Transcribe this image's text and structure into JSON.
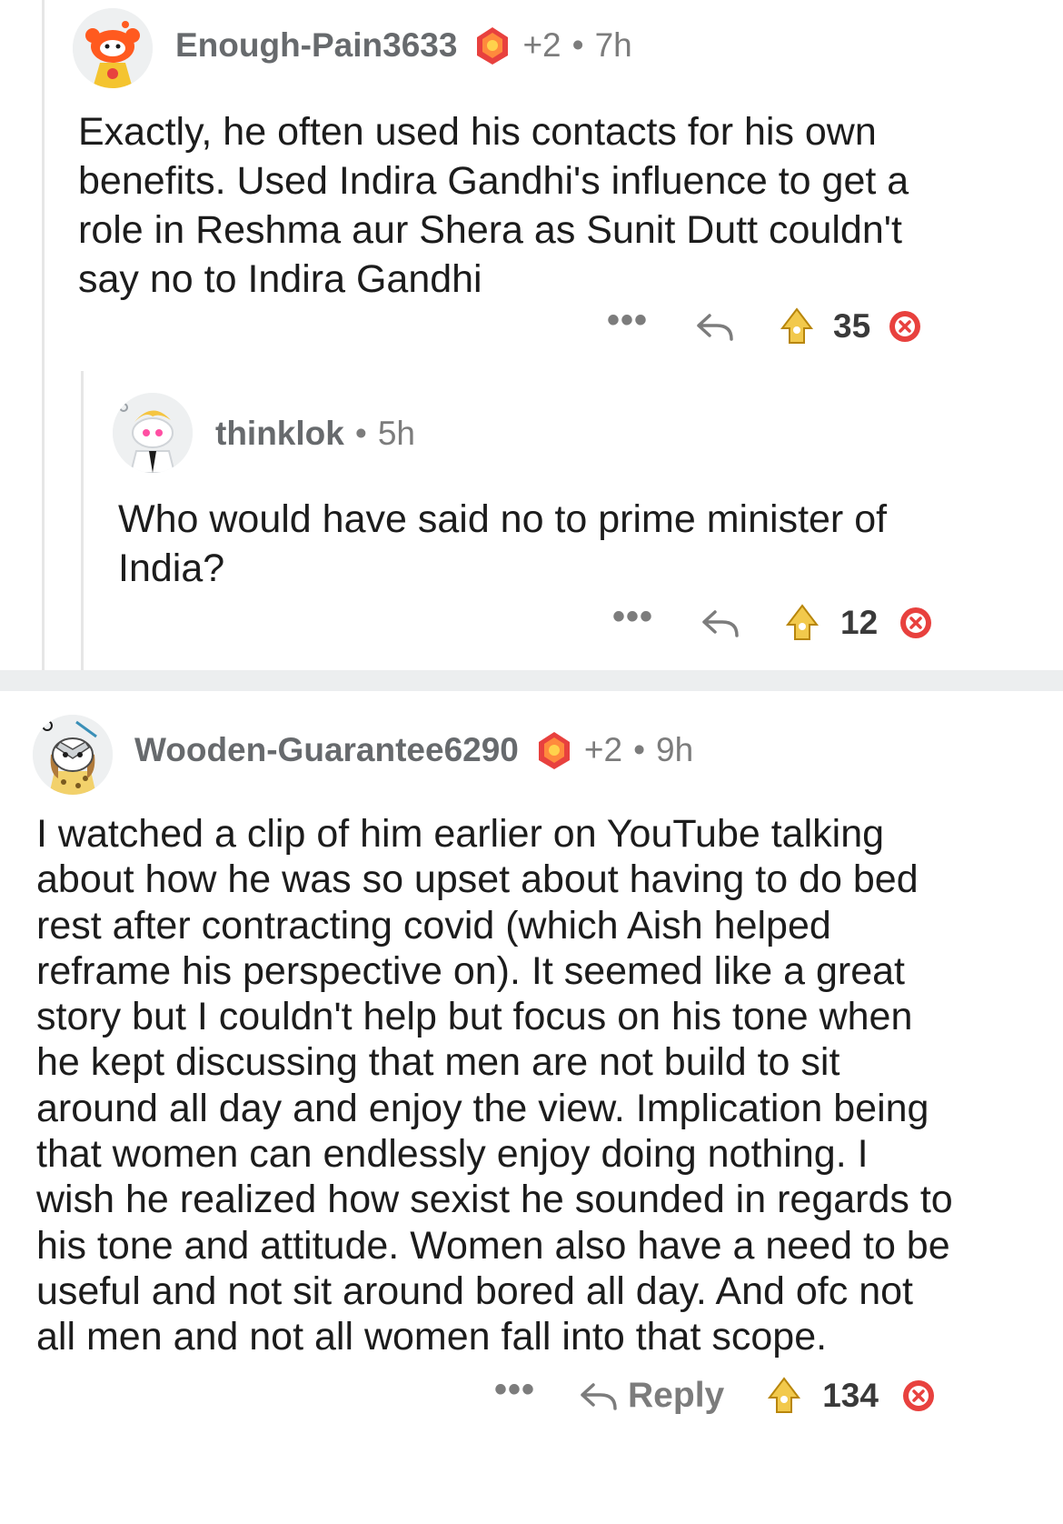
{
  "comments": [
    {
      "username": "Enough-Pain3633",
      "award_count": "+2",
      "separator": "•",
      "time": "7h",
      "body": "Exactly, he often used his contacts for his own\nbenefits. Used Indira Gandhi's influence to get a\nrole in Reshma aur Shera as Sunit Dutt couldn't\nsay no to Indira Gandhi",
      "more": "•••",
      "score": "35"
    },
    {
      "username": "thinklok",
      "separator": "•",
      "time": "5h",
      "body": "Who would have said no to prime minister of\nIndia?",
      "more": "•••",
      "score": "12"
    },
    {
      "username": "Wooden-Guarantee6290",
      "award_count": "+2",
      "separator": "•",
      "time": "9h",
      "body": "I watched a clip of him earlier on YouTube talking\nabout how he was so upset about having to do bed\nrest after contracting covid (which Aish helped\nreframe his perspective on). It seemed like a great\nstory but I couldn't help but focus on his tone when\nhe kept discussing that men are not build to sit\naround all day and enjoy the view. Implication being\nthat women can endlessly enjoy doing nothing. I\nwish he realized how sexist he sounded in regards to\nhis tone and attitude. Women also have a need to be\nuseful and not sit around bored all day. And ofc not\nall men and not all women fall into that scope.",
      "more": "•••",
      "reply_label": "Reply",
      "score": "134"
    }
  ],
  "colors": {
    "text": "#1c1c1c",
    "meta": "#7c7c7c",
    "thread_line": "#e6e6e6",
    "divider": "#eceeef",
    "downvote": "#e8413e",
    "upvote": "#f2c94c"
  }
}
